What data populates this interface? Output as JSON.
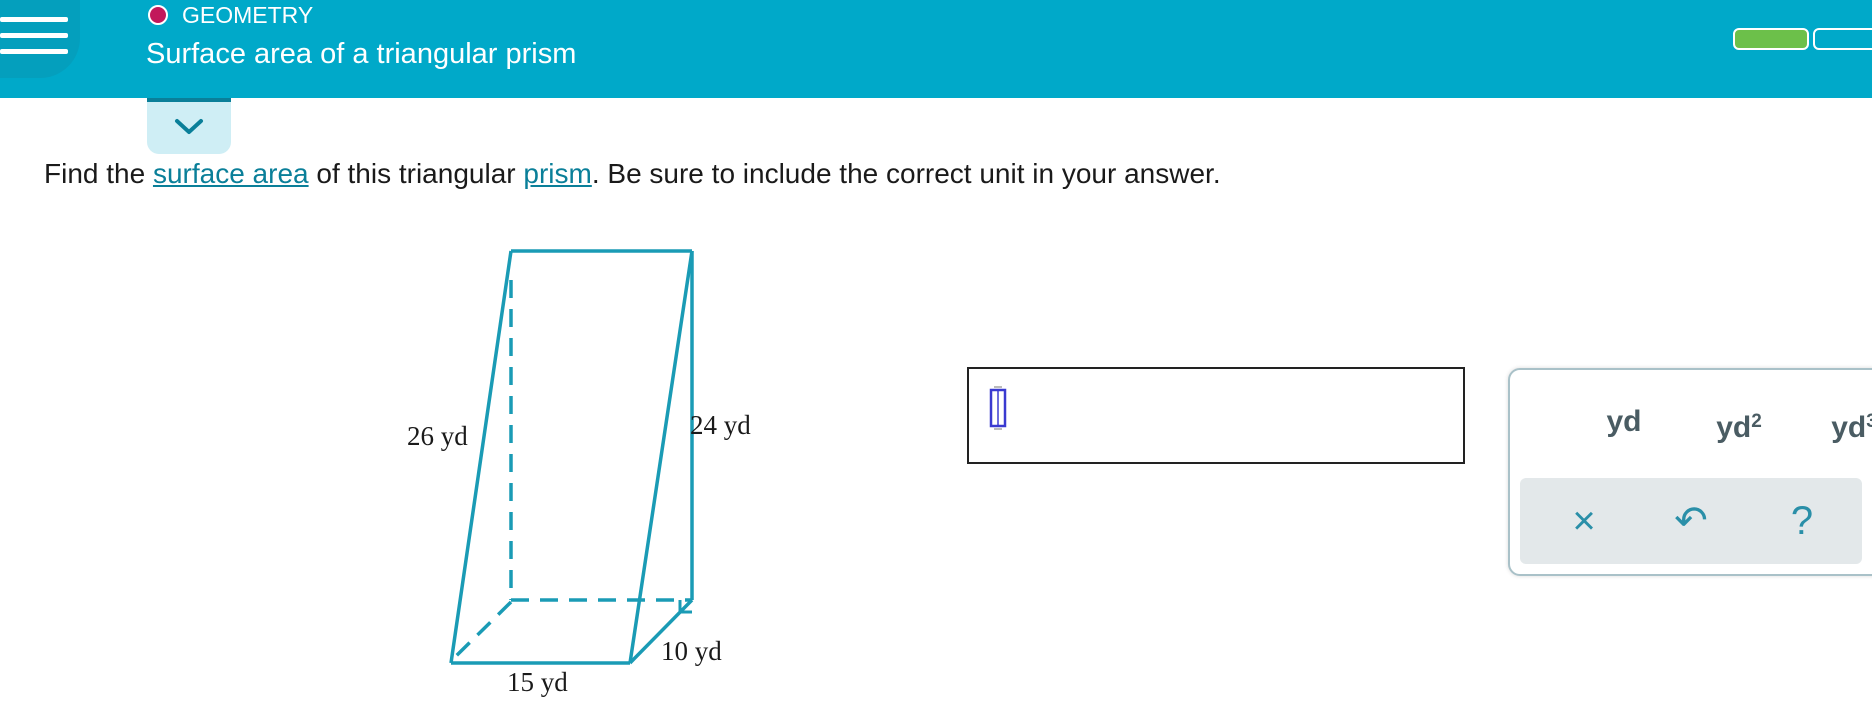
{
  "header": {
    "subject": "GEOMETRY",
    "title": "Surface area of a triangular prism",
    "colors": {
      "bar": "#00a9c9",
      "subject_dot": "#c2185b",
      "progress_fill": "#6cc04a"
    },
    "progress": {
      "completed": 1,
      "total": 2
    }
  },
  "question": {
    "prefix": "Find the ",
    "link1": "surface area",
    "middle": " of this triangular ",
    "link2": "prism",
    "suffix": ". Be sure to include the correct unit in your answer."
  },
  "figure": {
    "labels": {
      "slant": "26 yd",
      "height": "24 yd",
      "depth": "10 yd",
      "base": "15 yd"
    },
    "stroke_color": "#1a9bb5"
  },
  "answer": {
    "value": ""
  },
  "keypad": {
    "unit1": "yd",
    "unit2_base": "yd",
    "unit2_sup": "2",
    "unit3_base": "yd",
    "unit3_sup": "3",
    "clear_icon": "×",
    "undo_icon": "↶",
    "help_icon": "?"
  }
}
